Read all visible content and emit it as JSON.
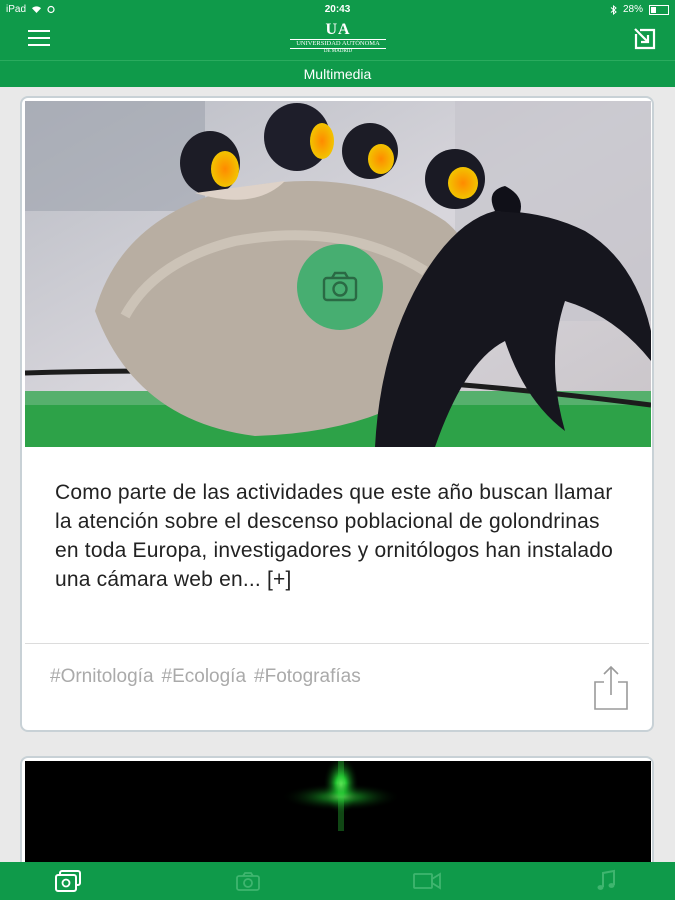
{
  "status_bar": {
    "device": "iPad",
    "time": "20:43",
    "battery": "28%",
    "battery_level": 0.28
  },
  "header": {
    "logo_mark": "UA",
    "logo_name": "UNIVERSIDAD AUTÓNOMA",
    "logo_sub": "DE MADRID",
    "menu_icon": "hamburger-icon",
    "exit_icon": "exit-arrow-icon"
  },
  "section": {
    "title": "Multimedia"
  },
  "posts": [
    {
      "media_type": "photo",
      "overlay_icon": "camera-icon",
      "excerpt": "Como parte de las actividades que este año buscan llamar la atención sobre el descenso poblacional de golondrinas en toda Europa, investigadores y ornitólogos han instalado una cámara web en... [+]",
      "tags": [
        "#Ornitología",
        "#Ecología",
        "#Fotografías"
      ],
      "share_icon": "share-icon"
    },
    {
      "media_type": "video"
    }
  ],
  "bottom_nav": [
    {
      "icon": "gallery-icon",
      "active": true
    },
    {
      "icon": "camera-icon",
      "active": false
    },
    {
      "icon": "video-camera-icon",
      "active": false
    },
    {
      "icon": "music-note-icon",
      "active": false
    }
  ],
  "colors": {
    "brand_green": "#0f9a4a",
    "inactive_icon": "#3fb56f",
    "tag_text": "#aaaaaa"
  }
}
